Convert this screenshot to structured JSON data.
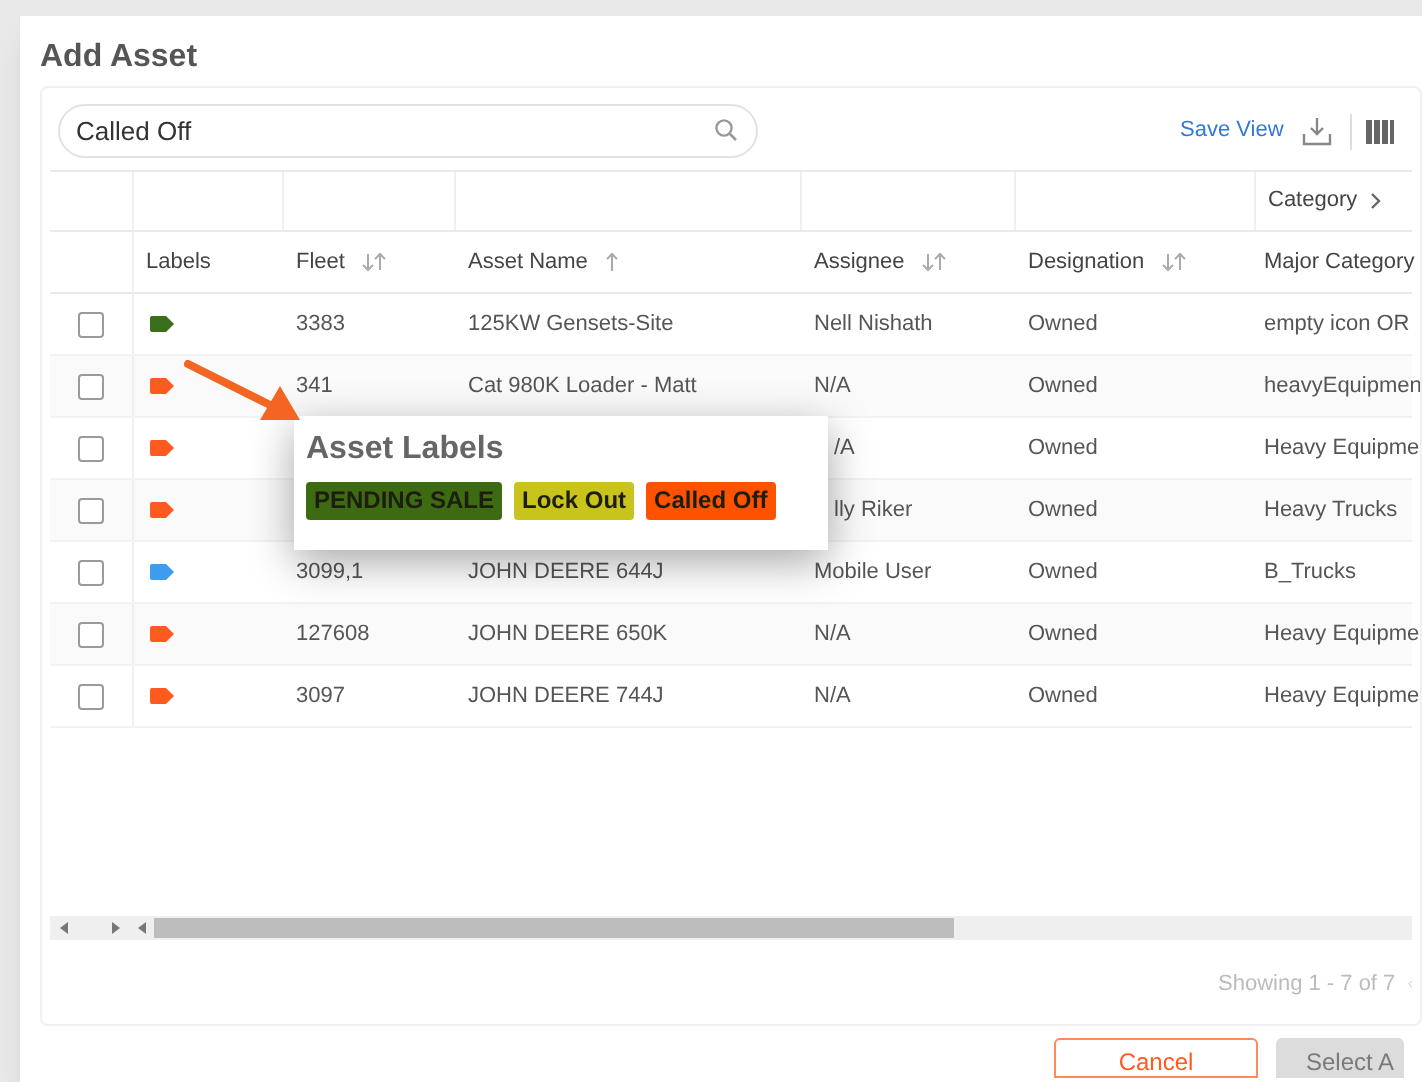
{
  "dialog": {
    "title": "Add Asset"
  },
  "toolbar": {
    "search": {
      "value": "Called Off"
    },
    "save_view": "Save View"
  },
  "group_header": "Category",
  "columns": [
    {
      "label": "Labels",
      "sortable": false,
      "sorted": false
    },
    {
      "label": "Fleet",
      "sortable": true,
      "sorted": false
    },
    {
      "label": "Asset Name",
      "sortable": true,
      "sorted": true
    },
    {
      "label": "Assignee",
      "sortable": true,
      "sorted": false
    },
    {
      "label": "Designation",
      "sortable": true,
      "sorted": false
    },
    {
      "label": "Major Category",
      "sortable": false,
      "sorted": false
    }
  ],
  "rows": [
    {
      "checked": false,
      "color": "#3a6e1a",
      "fleet": "3383",
      "asset_name": "125KW Gensets-Site",
      "assignee": "Nell Nishath",
      "designation": "Owned",
      "major_category": "empty icon OR"
    },
    {
      "checked": false,
      "color": "#ff5a1f",
      "fleet": "341",
      "asset_name": "Cat 980K Loader - Matt",
      "assignee": "N/A",
      "designation": "Owned",
      "major_category": "heavyEquipmen"
    },
    {
      "checked": false,
      "color": "#ff5a1f",
      "assignee": "/A",
      "designation": "Owned",
      "major_category": "Heavy Equipme"
    },
    {
      "checked": false,
      "color": "#ff5a1f",
      "assignee": "lly Riker",
      "designation": "Owned",
      "major_category": "Heavy Trucks"
    },
    {
      "checked": false,
      "color": "#3b9cf0",
      "fleet": "3099,1",
      "asset_name": "JOHN DEERE 644J",
      "assignee": "Mobile User",
      "designation": "Owned",
      "major_category": "B_Trucks"
    },
    {
      "checked": false,
      "color": "#ff5a1f",
      "fleet": "127608",
      "asset_name": "JOHN DEERE 650K",
      "assignee": "N/A",
      "designation": "Owned",
      "major_category": "Heavy Equipme"
    },
    {
      "checked": false,
      "color": "#ff5a1f",
      "fleet": "3097",
      "asset_name": "JOHN DEERE 744J",
      "assignee": "N/A",
      "designation": "Owned",
      "major_category": "Heavy Equipme"
    }
  ],
  "popup": {
    "title": "Asset Labels",
    "labels": [
      {
        "text": "PENDING SALE",
        "color": "#3d6b12"
      },
      {
        "text": "Lock Out",
        "color": "#c8c41c"
      },
      {
        "text": "Called Off",
        "color": "#ff5200"
      }
    ]
  },
  "footer": {
    "showing": "Showing 1 - 7 of 7"
  },
  "buttons": [
    {
      "label": "Cancel",
      "kind": "outline"
    },
    {
      "label": "Select A",
      "kind": "disabled"
    }
  ]
}
